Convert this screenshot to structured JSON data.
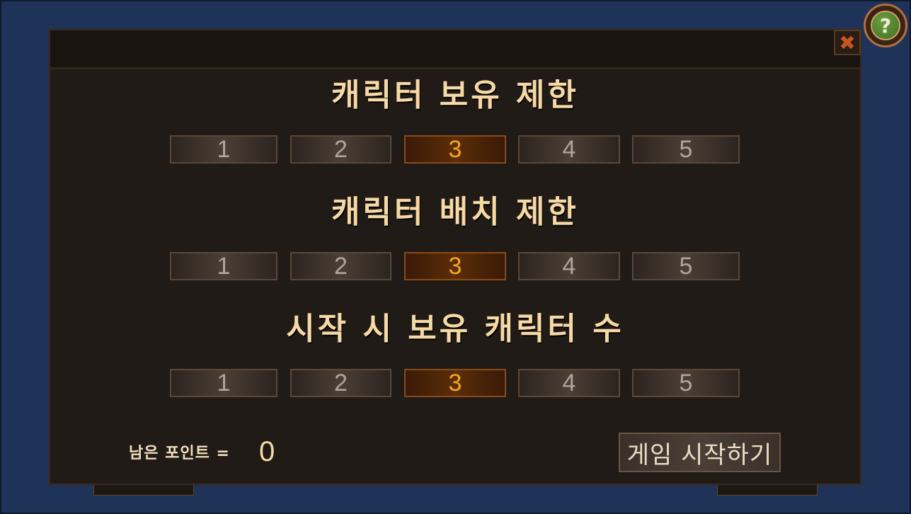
{
  "help": {
    "icon": "question-icon",
    "glyph": "?"
  },
  "close": {
    "icon": "close-x-icon",
    "glyph": "✖"
  },
  "sections": [
    {
      "title": "캐릭터 보유 제한",
      "options": [
        "1",
        "2",
        "3",
        "4",
        "5"
      ],
      "selected": "3"
    },
    {
      "title": "캐릭터 배치 제한",
      "options": [
        "1",
        "2",
        "3",
        "4",
        "5"
      ],
      "selected": "3"
    },
    {
      "title": "시작 시 보유 캐릭터 수",
      "options": [
        "1",
        "2",
        "3",
        "4",
        "5"
      ],
      "selected": "3"
    }
  ],
  "points": {
    "label": "남은 포인트 =",
    "value": "0"
  },
  "start_button": {
    "label": "게임 시작하기"
  },
  "colors": {
    "background": "#1f3358",
    "panel": "#211b17",
    "title_text": "#f6d9a4",
    "selected_text": "#f6a423",
    "close_icon": "#c8561e"
  }
}
